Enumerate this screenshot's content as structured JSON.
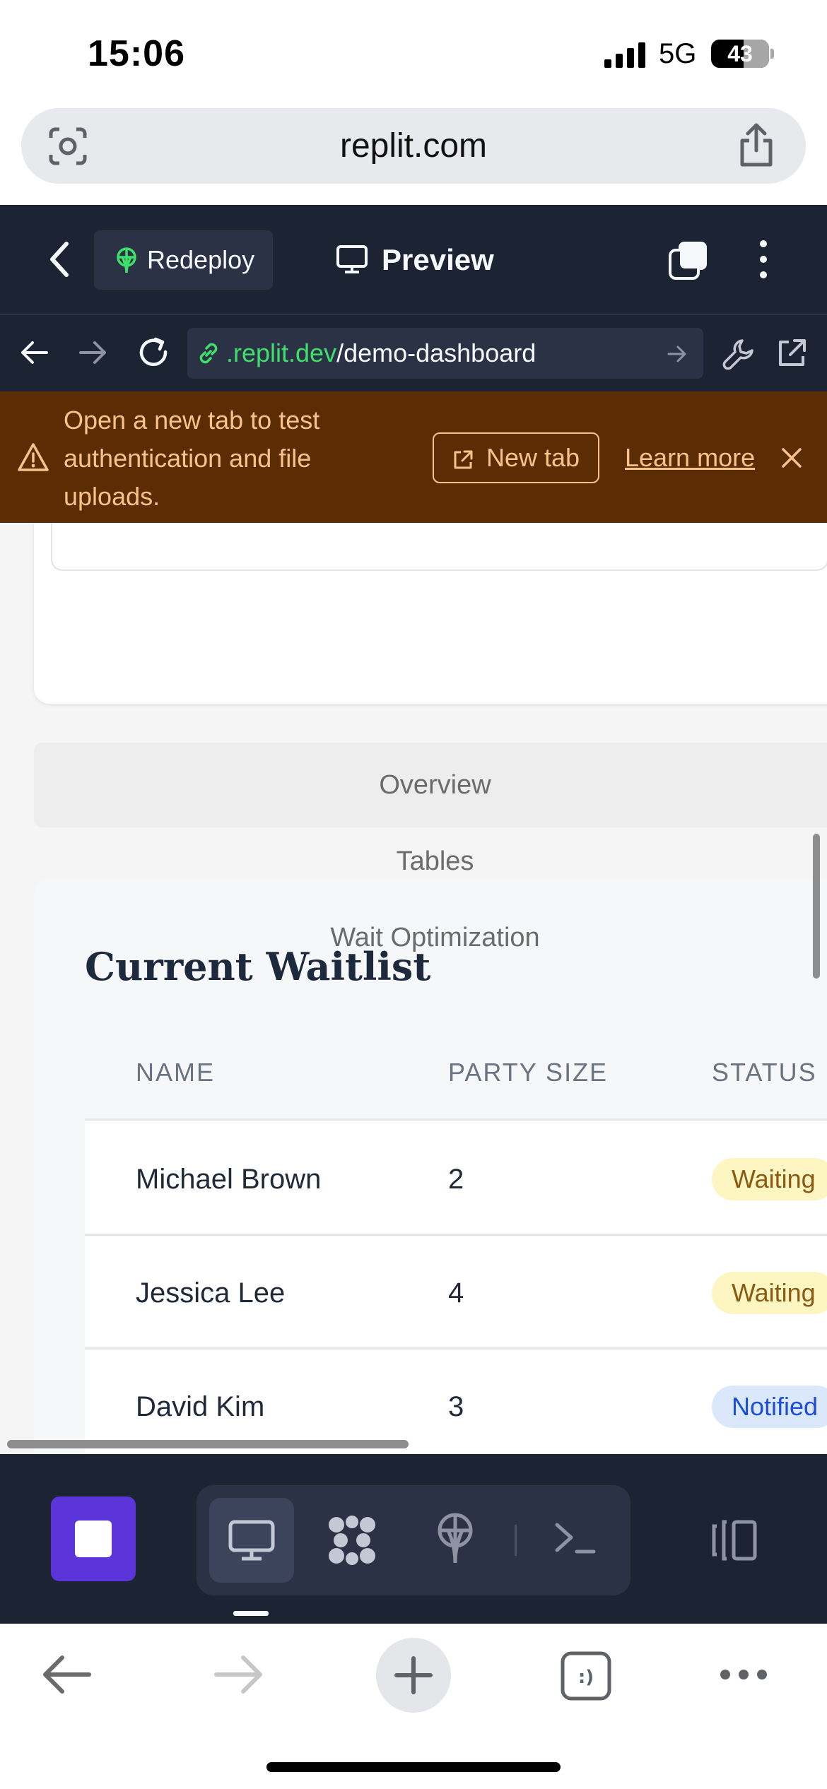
{
  "status_bar": {
    "time": "15:06",
    "network": "5G",
    "battery": "43"
  },
  "browser": {
    "url": "replit.com"
  },
  "replit_header": {
    "redeploy_label": "Redeploy",
    "preview_label": "Preview"
  },
  "preview_toolbar": {
    "address_domain": ".replit.dev",
    "address_path": "/demo-dashboard"
  },
  "banner": {
    "message": "Open a new tab to test authentication and file uploads.",
    "new_tab_label": "New tab",
    "learn_more_label": "Learn more"
  },
  "tabs": [
    "Overview",
    "Tables",
    "Wait Optimization"
  ],
  "waitlist": {
    "title": "Current Waitlist",
    "columns": [
      "NAME",
      "PARTY SIZE",
      "STATUS"
    ],
    "rows": [
      {
        "name": "Michael Brown",
        "party_size": "2",
        "status": "Waiting"
      },
      {
        "name": "Jessica Lee",
        "party_size": "4",
        "status": "Waiting"
      },
      {
        "name": "David Kim",
        "party_size": "3",
        "status": "Notified"
      }
    ]
  },
  "colors": {
    "replit_bg": "#1c2333",
    "banner_bg": "#5c2c04",
    "banner_text": "#f6c48a",
    "accent_purple": "#5b34da",
    "link_green": "#3ee06b",
    "waiting_badge": "#fdf6c3",
    "notified_badge": "#dbe8fb"
  },
  "icons": {
    "status": [
      "signal-icon",
      "battery-icon"
    ],
    "browser": [
      "lens-icon",
      "share-icon"
    ],
    "replit_header": [
      "back-chevron-icon",
      "deploy-icon",
      "monitor-icon",
      "tabs-icon",
      "more-vertical-icon"
    ],
    "preview_toolbar": [
      "arrow-left-icon",
      "arrow-right-icon",
      "reload-icon",
      "link-icon",
      "go-arrow-icon",
      "wrench-icon",
      "external-link-icon"
    ],
    "banner": [
      "warning-icon",
      "external-link-icon",
      "close-icon"
    ],
    "replit_bottom": [
      "stop-icon",
      "monitor-icon",
      "agent-icon",
      "deploy-icon",
      "terminal-icon",
      "layout-toggle-icon"
    ],
    "safari_bottom": [
      "back-arrow-icon",
      "forward-arrow-icon",
      "plus-icon",
      "tabs-icon",
      "more-horizontal-icon"
    ]
  }
}
